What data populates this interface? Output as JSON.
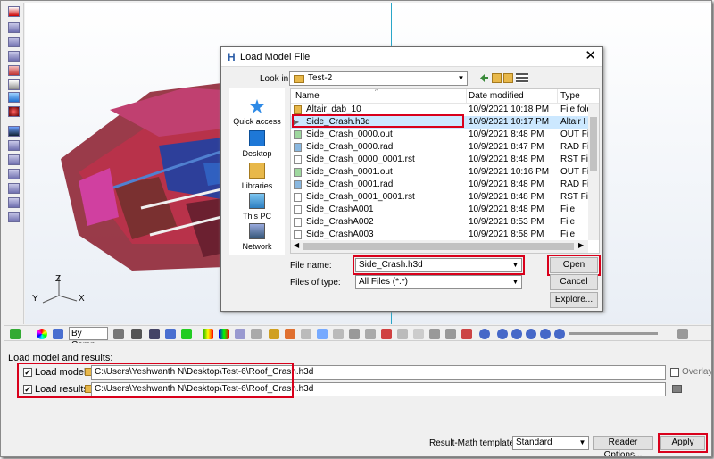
{
  "dialog": {
    "title": "Load Model File",
    "close_glyph": "✕",
    "look_in_label": "Look in:",
    "look_in_value": "Test-2",
    "places": [
      {
        "label": "Quick access",
        "icon": "star-icon"
      },
      {
        "label": "Desktop",
        "icon": "desktop-icon"
      },
      {
        "label": "Libraries",
        "icon": "libraries-icon"
      },
      {
        "label": "This PC",
        "icon": "computer-icon"
      },
      {
        "label": "Network",
        "icon": "network-icon"
      }
    ],
    "columns": {
      "name": "Name",
      "date": "Date modified",
      "type": "Type"
    },
    "files": [
      {
        "name": "Altair_dab_10",
        "date": "10/9/2021 10:18 PM",
        "type": "File fold",
        "icon": "folder-icon"
      },
      {
        "name": "Side_Crash.h3d",
        "date": "10/9/2021 10:17 PM",
        "type": "Altair H",
        "icon": "h3d-file-icon",
        "selected": true
      },
      {
        "name": "Side_Crash_0000.out",
        "date": "10/9/2021 8:48 PM",
        "type": "OUT File",
        "icon": "out-file-icon"
      },
      {
        "name": "Side_Crash_0000.rad",
        "date": "10/9/2021 8:47 PM",
        "type": "RAD File",
        "icon": "rad-file-icon"
      },
      {
        "name": "Side_Crash_0000_0001.rst",
        "date": "10/9/2021 8:48 PM",
        "type": "RST File",
        "icon": "file-icon"
      },
      {
        "name": "Side_Crash_0001.out",
        "date": "10/9/2021 10:16 PM",
        "type": "OUT File",
        "icon": "out-file-icon"
      },
      {
        "name": "Side_Crash_0001.rad",
        "date": "10/9/2021 8:48 PM",
        "type": "RAD File",
        "icon": "rad-file-icon"
      },
      {
        "name": "Side_Crash_0001_0001.rst",
        "date": "10/9/2021 8:48 PM",
        "type": "RST File",
        "icon": "file-icon"
      },
      {
        "name": "Side_CrashA001",
        "date": "10/9/2021 8:48 PM",
        "type": "File",
        "icon": "file-icon"
      },
      {
        "name": "Side_CrashA002",
        "date": "10/9/2021 8:53 PM",
        "type": "File",
        "icon": "file-icon"
      },
      {
        "name": "Side_CrashA003",
        "date": "10/9/2021 8:58 PM",
        "type": "File",
        "icon": "file-icon"
      }
    ],
    "file_name_label": "File name:",
    "file_name_value": "Side_Crash.h3d",
    "file_type_label": "Files of type:",
    "file_type_value": "All Files (*.*)",
    "open_label": "Open",
    "cancel_label": "Cancel",
    "explore_label": "Explore..."
  },
  "toolbar": {
    "display_mode": "By Comp"
  },
  "viewport": {
    "axis_z": "Z",
    "axis_y": "Y",
    "axis_x": "X"
  },
  "panel": {
    "title": "Load model and results:",
    "load_model_label": "Load model",
    "load_model_path": "C:\\Users\\Yeshwanth N\\Desktop\\Test-6\\Roof_Crash.h3d",
    "load_results_label": "Load results",
    "load_results_path": "C:\\Users\\Yeshwanth N\\Desktop\\Test-6\\Roof_Crash.h3d",
    "overlay_label": "Overlay",
    "result_math_label": "Result-Math template:",
    "result_math_value": "Standard",
    "reader_options_label": "Reader Options...",
    "apply_label": "Apply",
    "check_glyph": "✓"
  },
  "colors": {
    "highlight": "#d9001b",
    "selection": "#cce8ff",
    "guide_line": "#2aa6c8"
  }
}
